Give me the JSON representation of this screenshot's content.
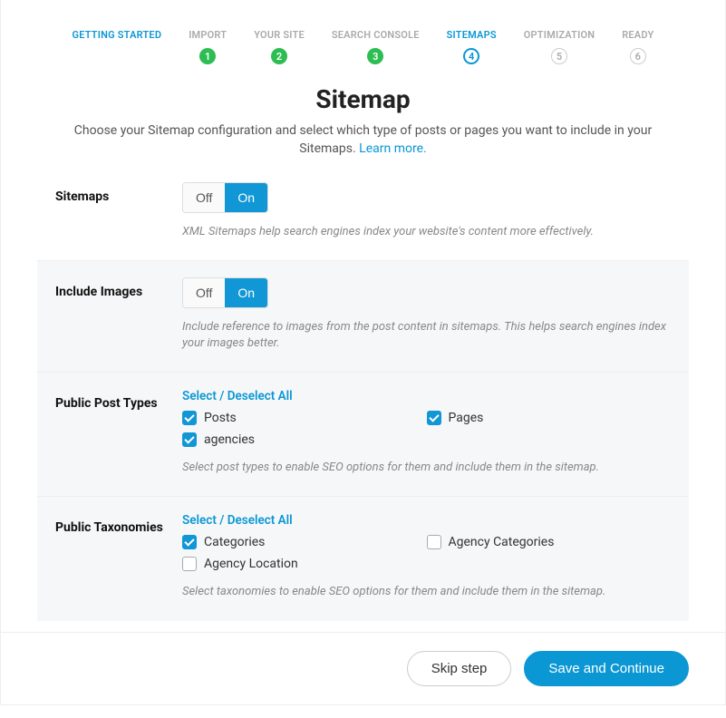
{
  "steps": [
    {
      "label": "GETTING STARTED",
      "state": "active"
    },
    {
      "label": "IMPORT",
      "num": "1",
      "state": "done"
    },
    {
      "label": "YOUR SITE",
      "num": "2",
      "state": "done"
    },
    {
      "label": "SEARCH CONSOLE",
      "num": "3",
      "state": "done"
    },
    {
      "label": "SITEMAPS",
      "num": "4",
      "state": "active"
    },
    {
      "label": "OPTIMIZATION",
      "num": "5",
      "state": "pending"
    },
    {
      "label": "READY",
      "num": "6",
      "state": "pending"
    }
  ],
  "header": {
    "title": "Sitemap",
    "description": "Choose your Sitemap configuration and select which type of posts or pages you want to include in your Sitemaps. ",
    "learn_more": "Learn more."
  },
  "sitemaps": {
    "label": "Sitemaps",
    "off": "Off",
    "on": "On",
    "value": "On",
    "hint": "XML Sitemaps help search engines index your website's content more effectively."
  },
  "images": {
    "label": "Include Images",
    "off": "Off",
    "on": "On",
    "value": "On",
    "hint": "Include reference to images from the post content in sitemaps. This helps search engines index your images better."
  },
  "post_types": {
    "label": "Public Post Types",
    "toggle_all": "Select / Deselect All",
    "items": [
      {
        "label": "Posts",
        "checked": true
      },
      {
        "label": "Pages",
        "checked": true
      },
      {
        "label": "agencies",
        "checked": true
      }
    ],
    "hint": "Select post types to enable SEO options for them and include them in the sitemap."
  },
  "taxonomies": {
    "label": "Public Taxonomies",
    "toggle_all": "Select / Deselect All",
    "items": [
      {
        "label": "Categories",
        "checked": true
      },
      {
        "label": "Agency Categories",
        "checked": false
      },
      {
        "label": "Agency Location",
        "checked": false
      }
    ],
    "hint": "Select taxonomies to enable SEO options for them and include them in the sitemap."
  },
  "footer": {
    "skip": "Skip step",
    "save": "Save and Continue"
  }
}
